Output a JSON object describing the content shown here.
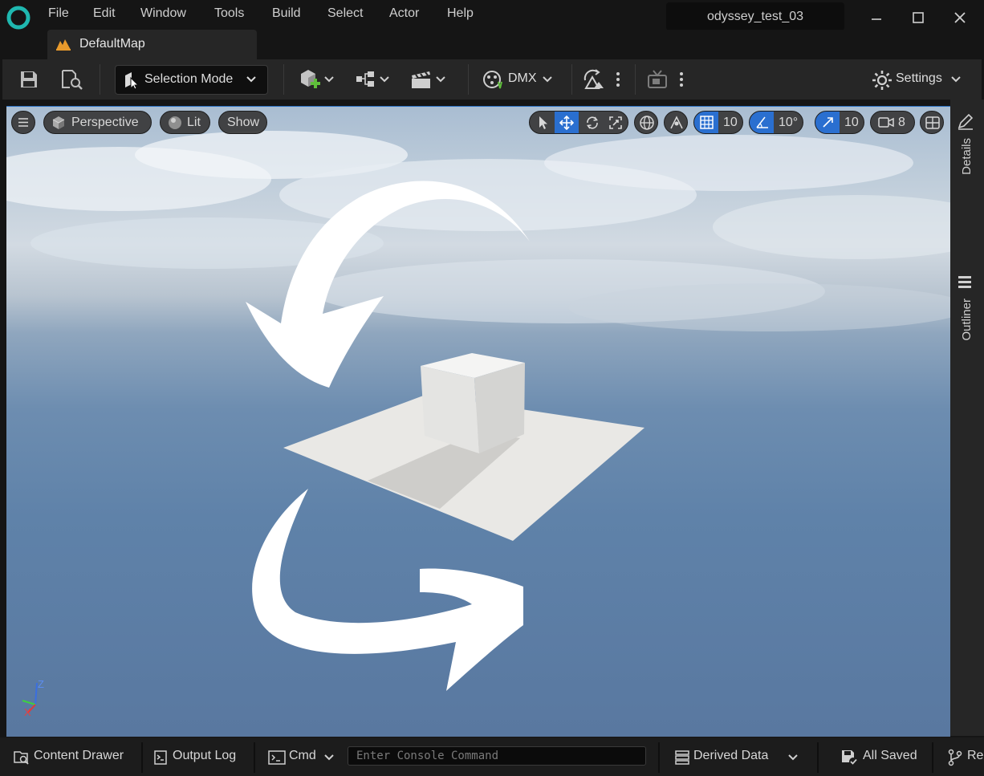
{
  "menu": [
    "File",
    "Edit",
    "Window",
    "Tools",
    "Build",
    "Select",
    "Actor",
    "Help"
  ],
  "project_name": "odyssey_test_03",
  "document_tab": "DefaultMap",
  "toolbar": {
    "selection_mode": "Selection Mode",
    "dmx": "DMX",
    "settings": "Settings"
  },
  "viewport": {
    "perspective": "Perspective",
    "lit": "Lit",
    "show": "Show",
    "grid_snap": "10",
    "rotation_snap": "10°",
    "scale_snap": "10",
    "camera_speed": "8",
    "axis_z": "Z",
    "axis_x": "X"
  },
  "side_panel": {
    "details": "Details",
    "outliner": "Outliner"
  },
  "status_bar": {
    "content_drawer": "Content Drawer",
    "output_log": "Output Log",
    "cmd": "Cmd",
    "console_placeholder": "Enter Console Command",
    "derived_data": "Derived Data",
    "all_saved": "All Saved",
    "revision_control": "Re"
  },
  "colors": {
    "accent": "#2a6fd0",
    "logo": "#1fb8b0",
    "background": "#151515",
    "toolbar": "#262626"
  }
}
